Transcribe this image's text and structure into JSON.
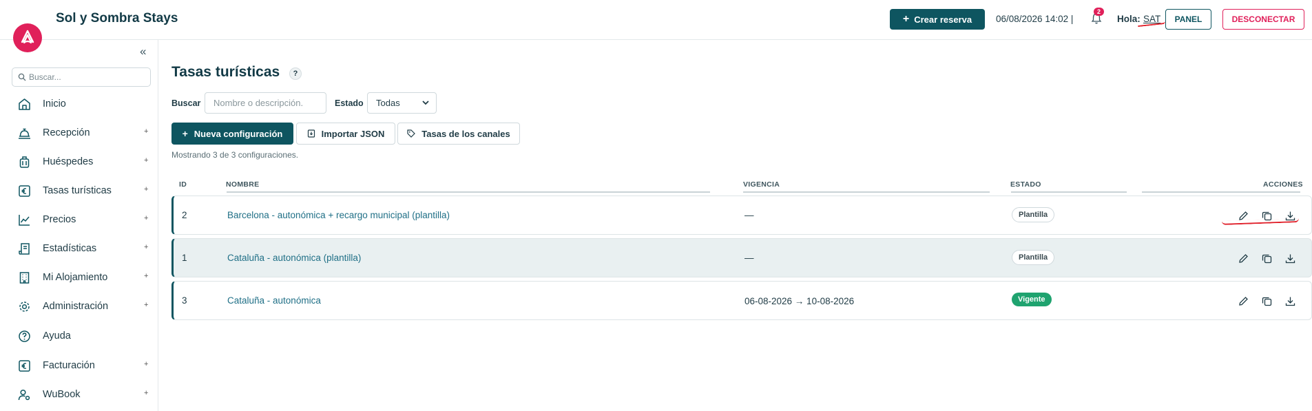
{
  "header": {
    "brand": "Sol y Sombra Stays",
    "create_label": "Crear reserva",
    "datetime": "06/08/2026 14:02 |",
    "notifications_count": "2",
    "greeting": "Hola:",
    "user": "SAT",
    "panel_label": "PANEL",
    "logout_label": "DESCONECTAR",
    "accent_color": "#0e5560",
    "brand_color": "#e0205a"
  },
  "sidebar": {
    "search_placeholder": "Buscar...",
    "items": [
      {
        "label": "Inicio",
        "icon": "home-icon",
        "expandable": false
      },
      {
        "label": "Recepción",
        "icon": "bell-service-icon",
        "expandable": true,
        "plus": "+"
      },
      {
        "label": "Huéspedes",
        "icon": "luggage-icon",
        "expandable": true,
        "plus": "+"
      },
      {
        "label": "Tasas turísticas",
        "icon": "euro-icon",
        "expandable": true,
        "plus": "+"
      },
      {
        "label": "Precios",
        "icon": "trend-chart-icon",
        "expandable": true,
        "plus": "+"
      },
      {
        "label": "Estadísticas",
        "icon": "document-icon",
        "expandable": true,
        "plus": "+"
      },
      {
        "label": "Mi Alojamiento",
        "icon": "building-icon",
        "expandable": true,
        "plus": "+"
      },
      {
        "label": "Administración",
        "icon": "gear-icon",
        "expandable": true,
        "plus": "+"
      },
      {
        "label": "Ayuda",
        "icon": "help-circle-icon",
        "expandable": false
      },
      {
        "label": "Facturación",
        "icon": "euro-icon",
        "expandable": true,
        "plus": "+"
      },
      {
        "label": "WuBook",
        "icon": "user-gear-icon",
        "expandable": true,
        "plus": "+"
      }
    ]
  },
  "main": {
    "title": "Tasas turísticas",
    "help": "?",
    "search_label": "Buscar",
    "search_placeholder": "Nombre o descripción.",
    "estado_label": "Estado",
    "estado_value": "Todas",
    "new_config_label": "Nueva configuración",
    "import_label": "Importar JSON",
    "channel_taxes_label": "Tasas de los canales",
    "showing_text": "Mostrando 3 de 3 configuraciones."
  },
  "table": {
    "headers": {
      "id": "ID",
      "nombre": "NOMBRE",
      "vigencia": "VIGENCIA",
      "estado": "ESTADO",
      "acciones": "ACCIONES"
    },
    "rows": [
      {
        "id": "2",
        "nombre": "Barcelona - autonómica + recargo municipal (plantilla)",
        "vigencia": "—",
        "estado": "Plantilla",
        "status_type": "gray"
      },
      {
        "id": "1",
        "nombre": "Cataluña - autonómica (plantilla)",
        "vigencia": "—",
        "estado": "Plantilla",
        "status_type": "gray"
      },
      {
        "id": "3",
        "nombre": "Cataluña - autonómica",
        "vigencia": "06-08-2026 → 10-08-2026",
        "estado": "Vigente",
        "status_type": "green"
      }
    ]
  }
}
